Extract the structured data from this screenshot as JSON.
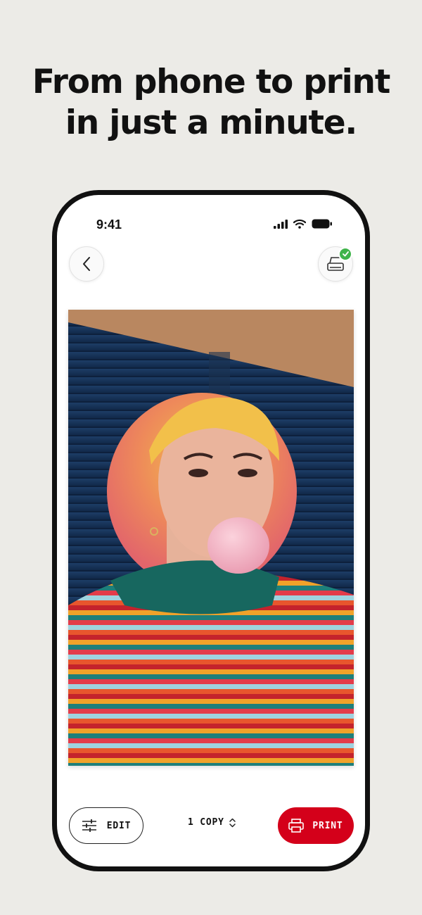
{
  "headline": {
    "line1": "From phone to print",
    "line2": "in just a minute."
  },
  "status_bar": {
    "time": "9:41",
    "icons": [
      "cellular-signal-icon",
      "wifi-icon",
      "battery-icon"
    ]
  },
  "nav": {
    "back_icon": "chevron-left-icon",
    "printer_icon": "printer-icon",
    "printer_status": "connected"
  },
  "photo": {
    "description_icon": "photo-preview"
  },
  "actions": {
    "edit_label": "EDIT",
    "copies_label": "1 COPY",
    "print_label": "PRINT"
  },
  "colors": {
    "accent": "#d4001a",
    "connected": "#3fb44a",
    "background": "#ecebe7"
  }
}
